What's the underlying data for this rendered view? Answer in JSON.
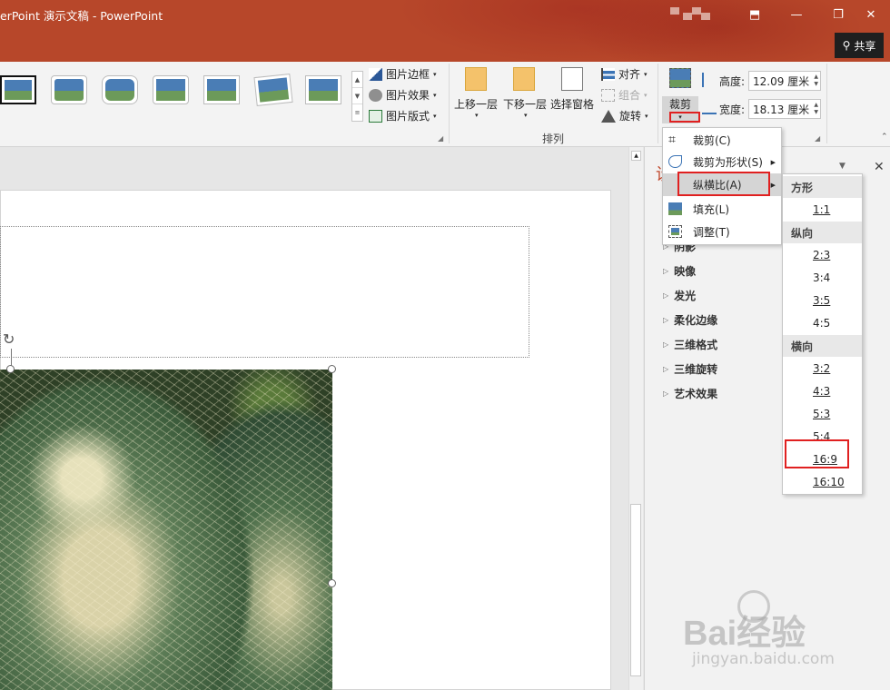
{
  "title_bar": {
    "title": "erPoint 演示文稿  -  PowerPoint",
    "share_label": "共享"
  },
  "ribbon": {
    "picture_border": "图片边框",
    "picture_effects": "图片效果",
    "picture_layout": "图片版式",
    "bring_forward": "上移一层",
    "send_backward": "下移一层",
    "selection_pane": "选择窗格",
    "align": "对齐",
    "group": "组合",
    "rotate": "旋转",
    "arrange_group_label": "排列",
    "crop_label": "裁剪",
    "height_label": "高度:",
    "height_value": "12.09 厘米",
    "width_label": "宽度:",
    "width_value": "18.13 厘米"
  },
  "crop_menu": {
    "items": [
      {
        "label": "裁剪(C)"
      },
      {
        "label": "裁剪为形状(S)"
      },
      {
        "label": "纵横比(A)"
      },
      {
        "label": "填充(L)"
      },
      {
        "label": "调整(T)"
      }
    ]
  },
  "aspect_menu": {
    "square_header": "方形",
    "square": [
      "1:1"
    ],
    "portrait_header": "纵向",
    "portrait": [
      "2:3",
      "3:4",
      "3:5",
      "4:5"
    ],
    "landscape_header": "横向",
    "landscape": [
      "3:2",
      "4:3",
      "5:3",
      "5:4",
      "16:9",
      "16:10"
    ]
  },
  "format_pane": {
    "title_fragment": "设",
    "items": [
      "阴影",
      "映像",
      "发光",
      "柔化边缘",
      "三维格式",
      "三维旋转",
      "艺术效果"
    ]
  },
  "watermark": {
    "brand": "Bai经验",
    "url": "jingyan.baidu.com"
  },
  "colors": {
    "title_bar": "#b7472a",
    "highlight_box": "#e02020"
  }
}
